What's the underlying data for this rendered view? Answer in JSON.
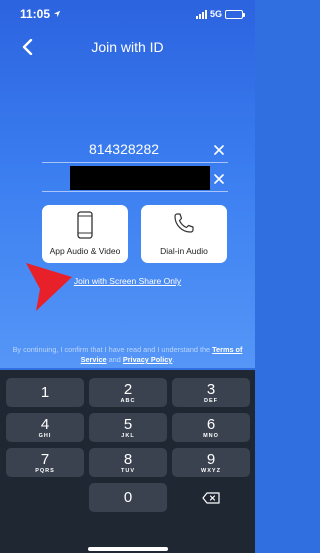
{
  "status": {
    "time": "11:05",
    "network": "5G"
  },
  "header": {
    "title": "Join with ID"
  },
  "form": {
    "meeting_id": "814328282",
    "name": ""
  },
  "options": [
    {
      "label": "App Audio & Video",
      "icon": "phone-device-icon"
    },
    {
      "label": "Dial-in Audio",
      "icon": "phone-handset-icon"
    }
  ],
  "share_link": "Join with Screen Share Only",
  "legal": {
    "prefix": "By continuing, I confirm that I have read and I understand the",
    "terms": "Terms of Service",
    "and": "and",
    "privacy": "Privacy Policy",
    "suffix": "."
  },
  "keypad": {
    "keys": [
      {
        "num": "1",
        "letters": ""
      },
      {
        "num": "2",
        "letters": "ABC"
      },
      {
        "num": "3",
        "letters": "DEF"
      },
      {
        "num": "4",
        "letters": "GHI"
      },
      {
        "num": "5",
        "letters": "JKL"
      },
      {
        "num": "6",
        "letters": "MNO"
      },
      {
        "num": "7",
        "letters": "PQRS"
      },
      {
        "num": "8",
        "letters": "TUV"
      },
      {
        "num": "9",
        "letters": "WXYZ"
      },
      {
        "num": "0",
        "letters": ""
      }
    ]
  },
  "colors": {
    "accent": "#2f6fe0",
    "annotation_arrow": "#e8202a",
    "keypad_bg": "#1f2733",
    "key_bg": "#3a4250"
  }
}
